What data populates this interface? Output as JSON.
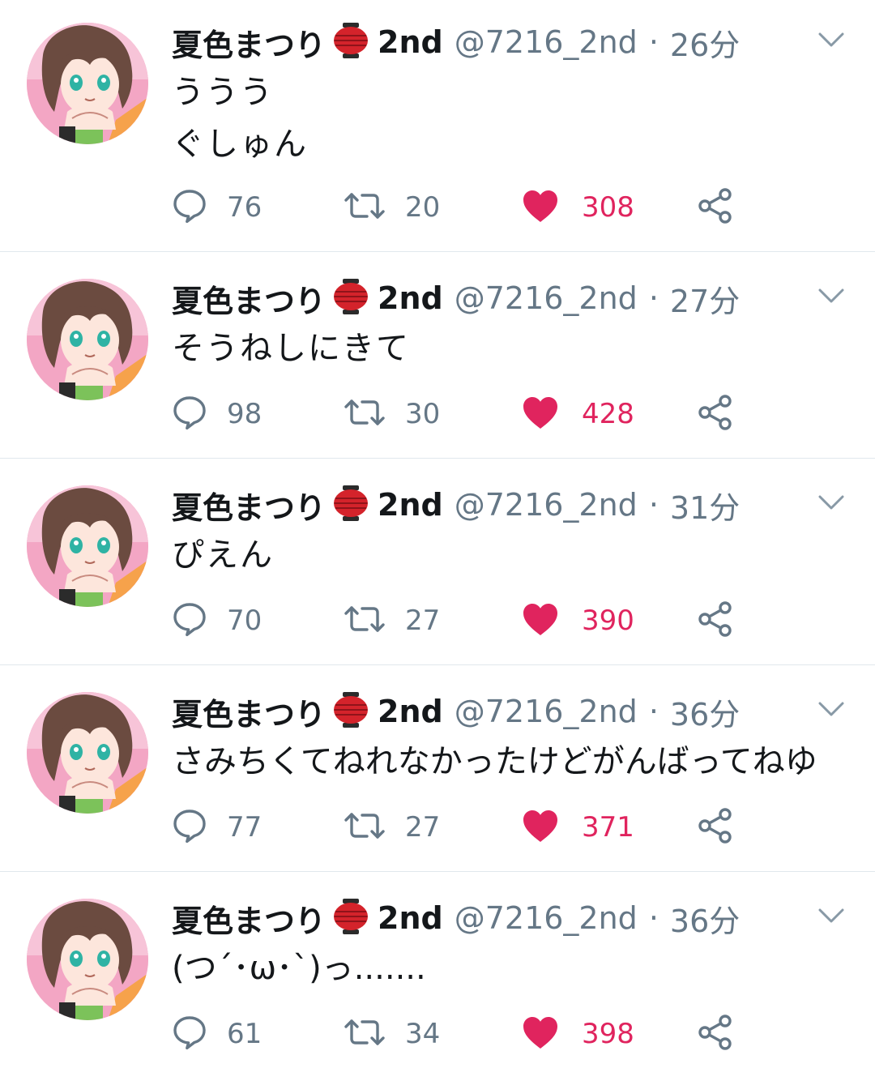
{
  "tweets": [
    {
      "name": "夏色まつり",
      "name_suffix": "2nd",
      "handle": "@7216_2nd",
      "separator": "·",
      "time": "26分",
      "text": "ううう\nぐしゅん",
      "replies": "76",
      "retweets": "20",
      "likes": "308"
    },
    {
      "name": "夏色まつり",
      "name_suffix": "2nd",
      "handle": "@7216_2nd",
      "separator": "·",
      "time": "27分",
      "text": "そうねしにきて",
      "replies": "98",
      "retweets": "30",
      "likes": "428"
    },
    {
      "name": "夏色まつり",
      "name_suffix": "2nd",
      "handle": "@7216_2nd",
      "separator": "·",
      "time": "31分",
      "text": "ぴえん",
      "replies": "70",
      "retweets": "27",
      "likes": "390"
    },
    {
      "name": "夏色まつり",
      "name_suffix": "2nd",
      "handle": "@7216_2nd",
      "separator": "·",
      "time": "36分",
      "text": "さみちくてねれなかったけどがんばってねゆ",
      "replies": "77",
      "retweets": "27",
      "likes": "371"
    },
    {
      "name": "夏色まつり",
      "name_suffix": "2nd",
      "handle": "@7216_2nd",
      "separator": "·",
      "time": "36分",
      "text": "(つ´･ω･`)っ.......",
      "replies": "61",
      "retweets": "34",
      "likes": "398"
    }
  ],
  "icons": {
    "lantern": "red-lantern-emoji",
    "menu": "chevron-down-icon",
    "reply": "reply-bubble-icon",
    "retweet": "retweet-icon",
    "like": "heart-icon",
    "share": "share-icon"
  },
  "colors": {
    "text": "#14171a",
    "secondary": "#657786",
    "like": "#e0245e",
    "divider": "#e1e8ed"
  }
}
